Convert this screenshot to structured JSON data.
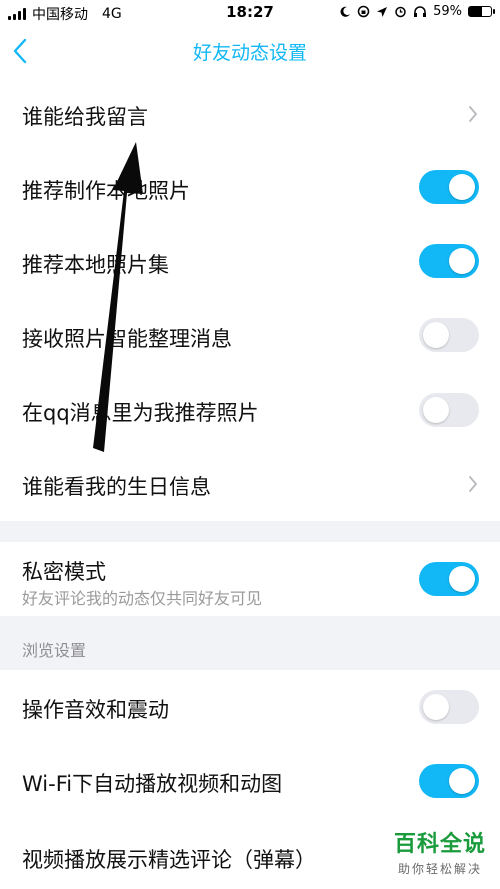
{
  "status_bar": {
    "carrier": "中国移动",
    "network": "4G",
    "time": "18:27",
    "battery_percent_label": "59%",
    "battery_level": 0.59
  },
  "nav": {
    "title": "好友动态设置"
  },
  "rows": [
    {
      "label": "谁能给我留言",
      "type": "chevron"
    },
    {
      "label": "推荐制作本地照片",
      "type": "toggle",
      "on": true
    },
    {
      "label": "推荐本地照片集",
      "type": "toggle",
      "on": true
    },
    {
      "label": "接收照片智能整理消息",
      "type": "toggle",
      "on": false
    },
    {
      "label": "在qq消息里为我推荐照片",
      "type": "toggle",
      "on": false
    },
    {
      "label": "谁能看我的生日信息",
      "type": "chevron"
    }
  ],
  "private_mode": {
    "label": "私密模式",
    "sublabel": "好友评论我的动态仅共同好友可见",
    "on": true
  },
  "browse_section": {
    "title": "浏览设置",
    "rows": [
      {
        "label": "操作音效和震动",
        "on": false
      },
      {
        "label": "Wi-Fi下自动播放视频和动图",
        "on": true
      },
      {
        "label": "视频播放展示精选评论（弹幕）",
        "on": null
      }
    ]
  },
  "watermark": {
    "title": "百科全说",
    "subtitle": "助你轻松解决"
  },
  "colors": {
    "accent": "#12b7f5",
    "toggle_off": "#e7e9ee",
    "section_bg": "#f2f3f6"
  }
}
